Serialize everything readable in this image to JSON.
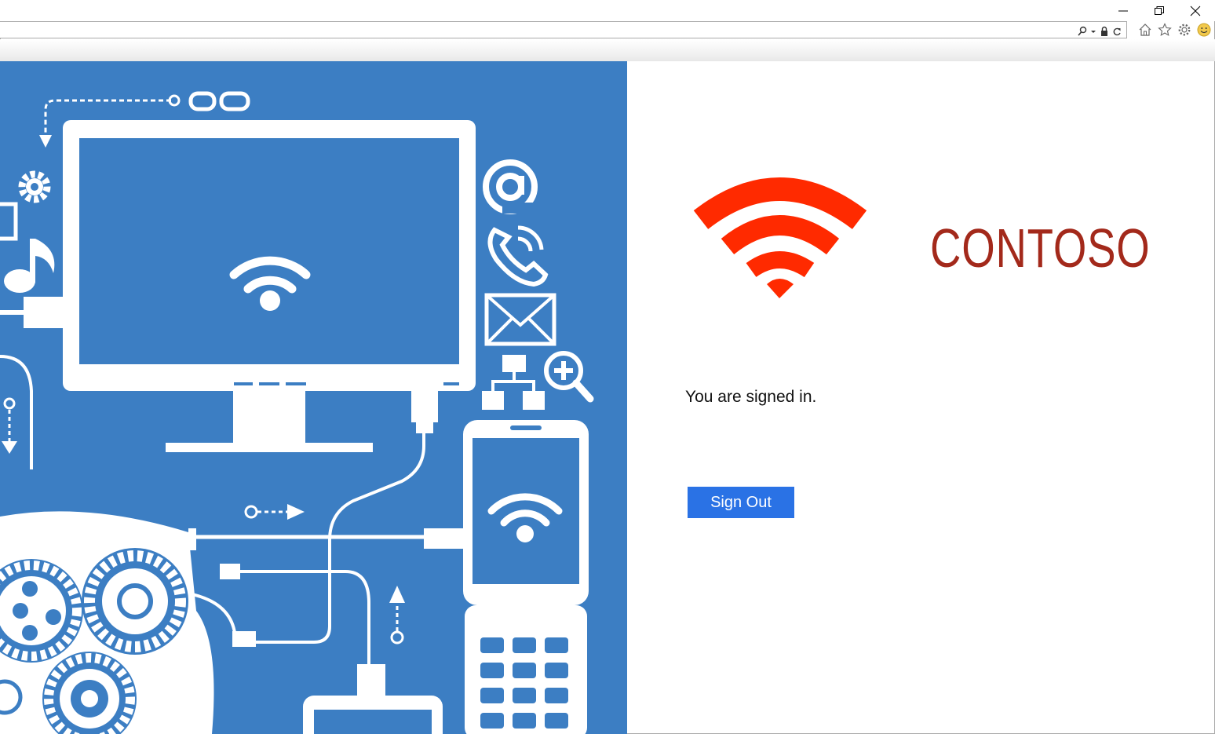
{
  "window": {
    "controls": [
      "minimize",
      "restore",
      "close"
    ]
  },
  "address_bar": {
    "url": "",
    "icons": [
      "search-icon",
      "dropdown-icon",
      "lock-icon",
      "refresh-icon"
    ]
  },
  "browser_toolbar": {
    "icons": [
      "home-icon",
      "favorites-star-icon",
      "settings-gear-icon",
      "feedback-smiley-icon"
    ]
  },
  "colors": {
    "hero_background": "#3c7ec3",
    "logo_red": "#ff2a00",
    "logo_text": "#a3291b",
    "button_blue": "#2a72e5"
  },
  "brand": {
    "name": "CONTOSO"
  },
  "main": {
    "status": "You are signed in.",
    "sign_out_label": "Sign Out"
  }
}
